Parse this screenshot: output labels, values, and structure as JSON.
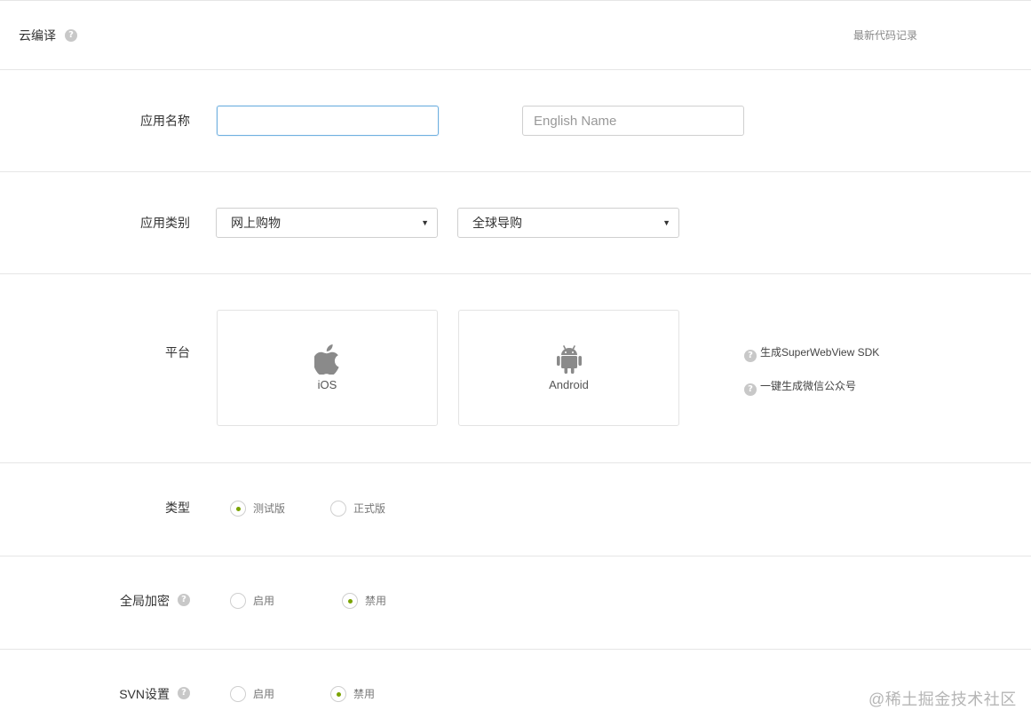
{
  "header": {
    "title": "云编译",
    "help_glyph": "?",
    "latest_link": "最新代码记录"
  },
  "app_name": {
    "label": "应用名称",
    "name_value": "",
    "english_placeholder": "English Name"
  },
  "app_category": {
    "label": "应用类别",
    "primary": "网上购物",
    "secondary": "全球导购",
    "caret": "▼"
  },
  "platform": {
    "label": "平台",
    "options": [
      {
        "label": "iOS",
        "icon": "apple-icon"
      },
      {
        "label": "Android",
        "icon": "android-icon"
      }
    ],
    "links": [
      "生成SuperWebView SDK",
      "一键生成微信公众号"
    ]
  },
  "build_type": {
    "label": "类型",
    "options": [
      "测试版",
      "正式版"
    ],
    "selected": "测试版"
  },
  "encryption": {
    "label": "全局加密",
    "options": [
      "启用",
      "禁用"
    ],
    "selected": "禁用"
  },
  "svn": {
    "label": "SVN设置",
    "options": [
      "启用",
      "禁用"
    ],
    "selected": "禁用"
  },
  "watermark": "@稀土掘金技术社区",
  "colors": {
    "accent_radio": "#7aa300",
    "focus_border": "#6fb0e0",
    "divider": "#e6e6e6",
    "icon_gray": "#8a8a8a"
  }
}
